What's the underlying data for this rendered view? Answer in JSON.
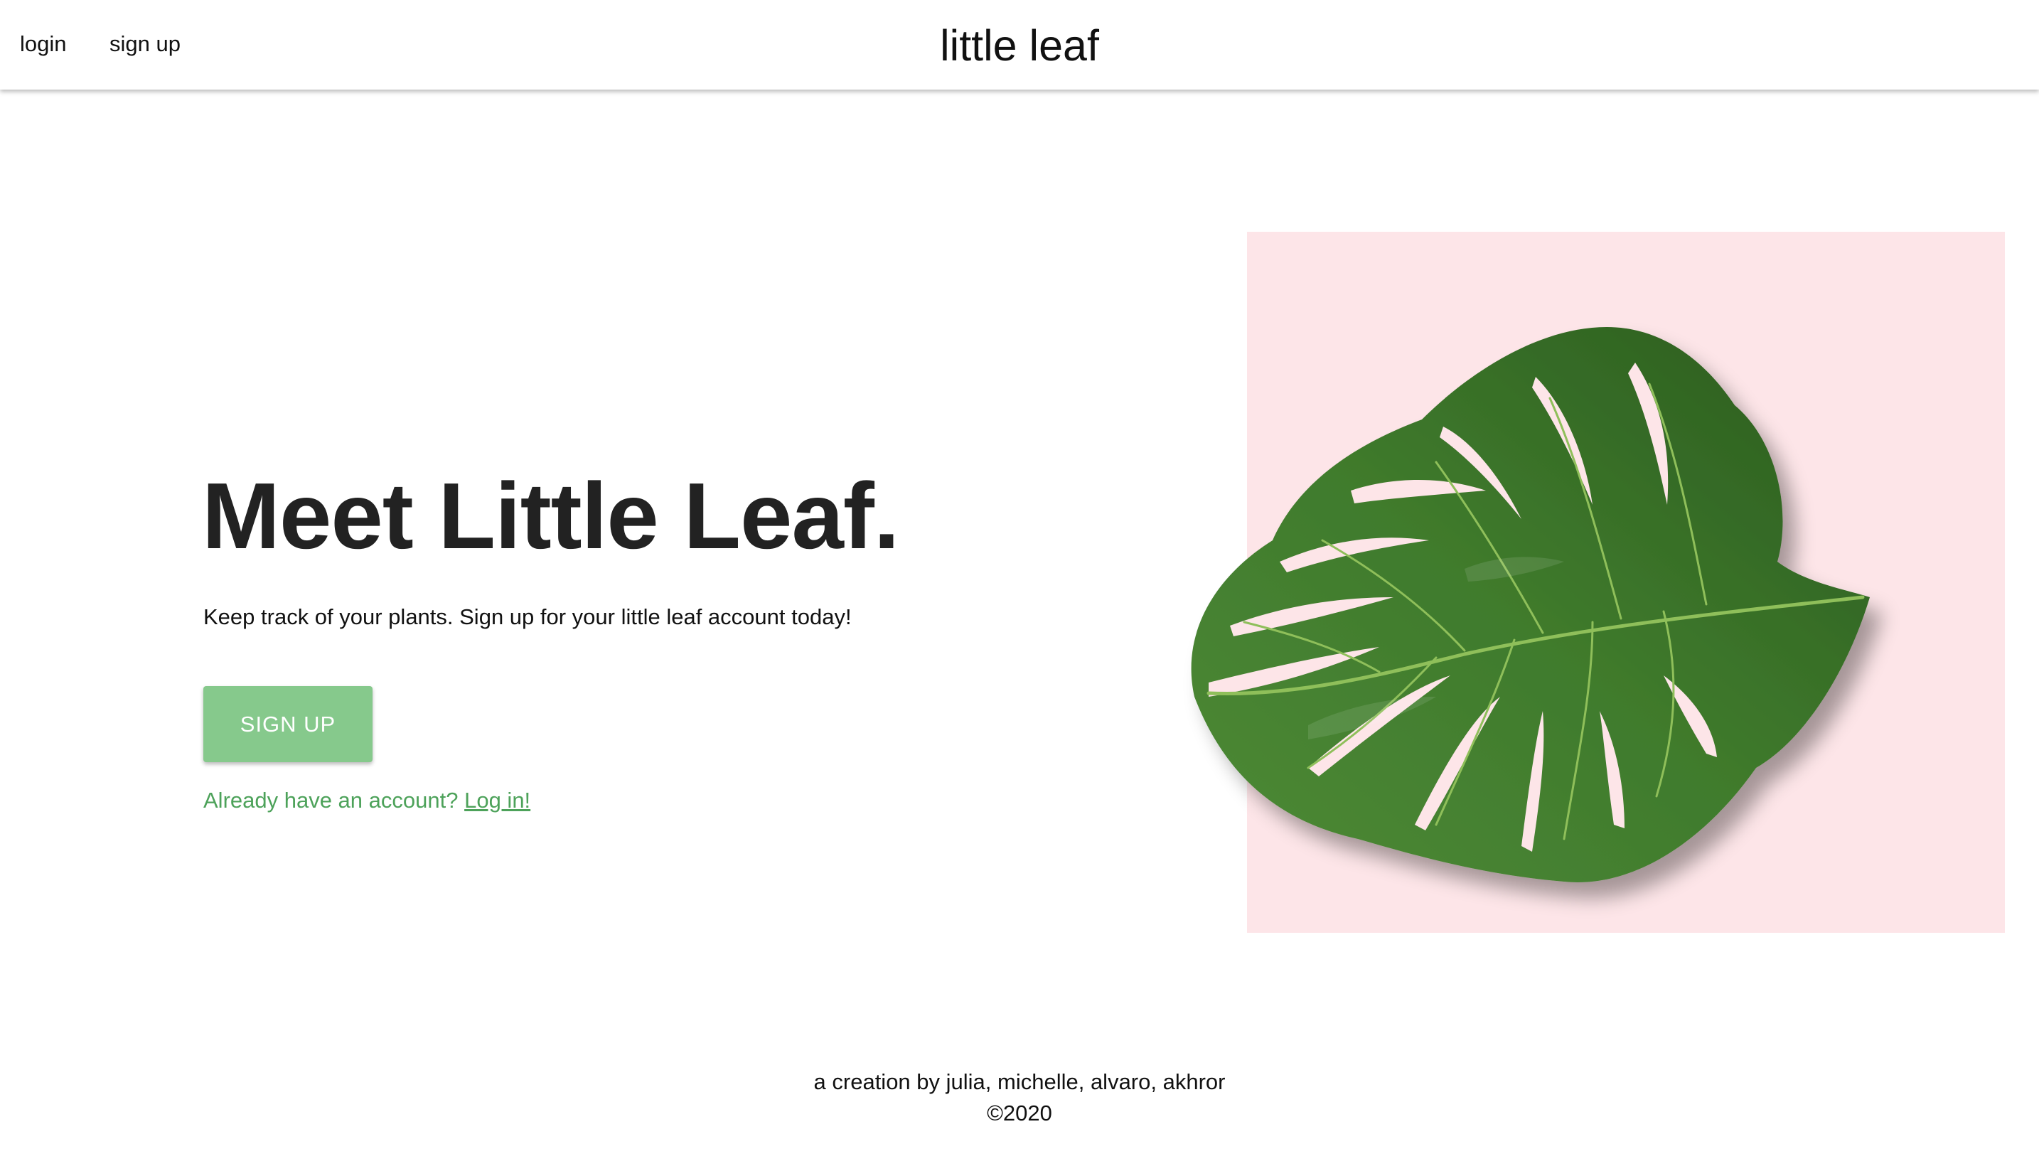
{
  "nav": {
    "brand": "little leaf",
    "login_label": "login",
    "signup_label": "sign up"
  },
  "hero": {
    "title": "Meet Little Leaf.",
    "subtitle": "Keep track of your plants. Sign up for your little leaf account today!",
    "cta_label": "SIGN UP",
    "account_prompt": "Already have an account?",
    "login_link": "Log in!"
  },
  "image": {
    "subject": "monstera-leaf",
    "background_color": "#fde5e8"
  },
  "footer": {
    "credits": "a creation by julia, michelle, alvaro, akhror",
    "copyright": "©2020"
  },
  "colors": {
    "accent_green": "#86c98c",
    "link_green": "#4da25a",
    "heading": "#222222"
  }
}
